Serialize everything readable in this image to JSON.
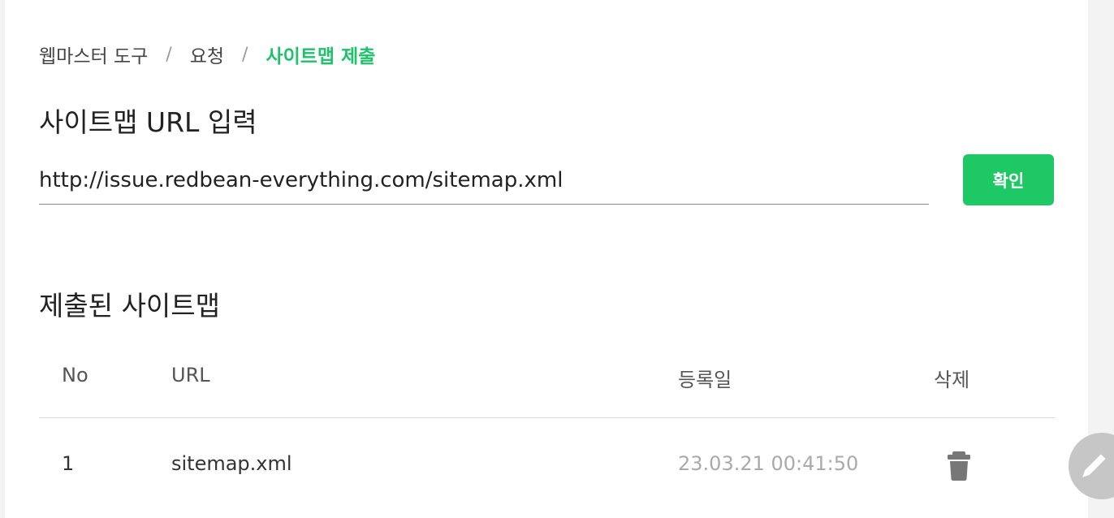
{
  "breadcrumb": {
    "items": [
      "웹마스터 도구",
      "요청",
      "사이트맵 제출"
    ],
    "separator": "/"
  },
  "sitemap_input": {
    "title": "사이트맵 URL 입력",
    "value": "http://issue.redbean-everything.com/sitemap.xml",
    "confirm_label": "확인"
  },
  "submitted": {
    "title": "제출된 사이트맵",
    "columns": {
      "no": "No",
      "url": "URL",
      "date": "등록일",
      "delete": "삭제"
    },
    "rows": [
      {
        "no": "1",
        "url": "sitemap.xml",
        "date": "23.03.21 00:41:50",
        "delete_icon": "trash-icon"
      }
    ]
  },
  "colors": {
    "accent": "#1ec864",
    "breadcrumb_active": "#1ec26a",
    "muted_date": "#aaaaaa"
  },
  "fab_icon": "pencil-icon"
}
